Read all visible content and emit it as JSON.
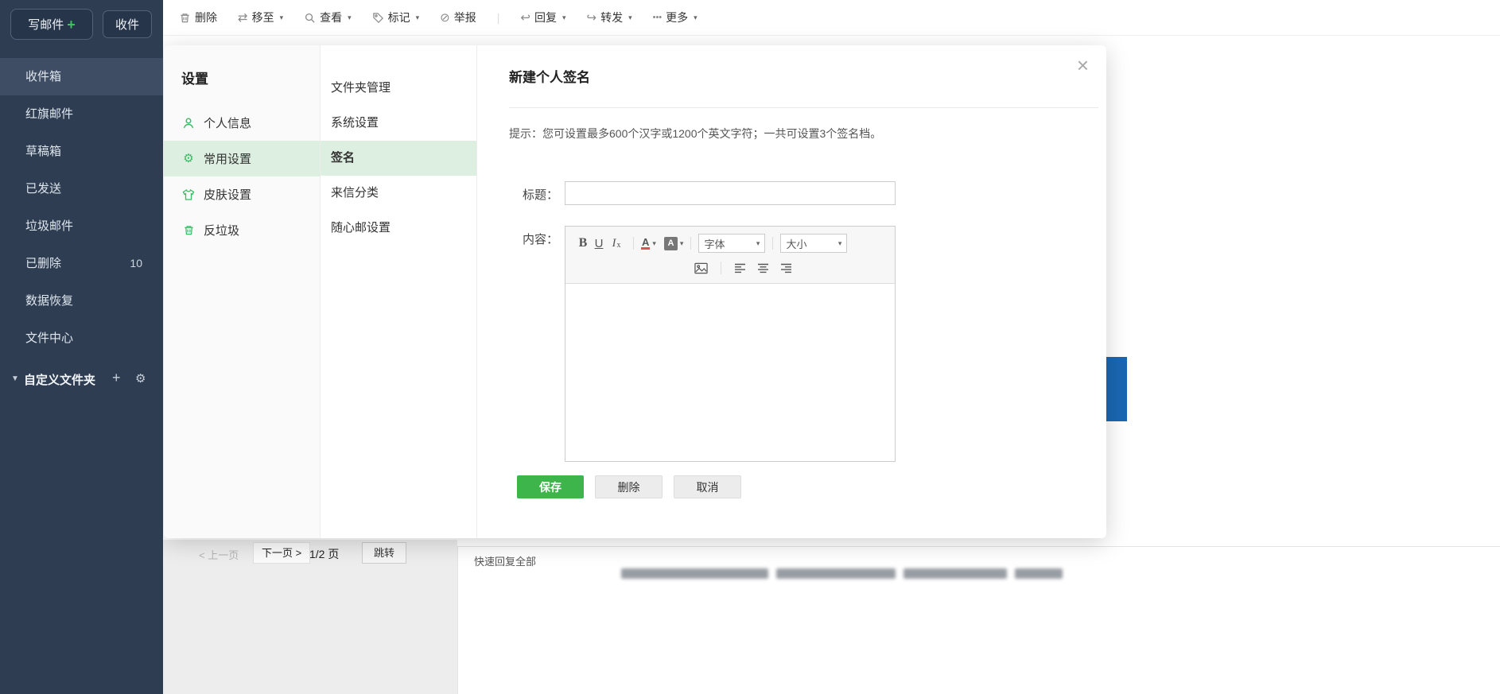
{
  "colors": {
    "accent_green": "#3db54a",
    "selection_green": "#dcefe0",
    "sidebar_bg": "#2e3d52",
    "sidebar_active_bg": "#3e4d63",
    "background_blue_fragment": "#1a67b2"
  },
  "icons": {
    "caret_down": "▾",
    "folder_caret": "▼",
    "plus": "+",
    "gear": "⚙",
    "close": "×",
    "more_dots": "•••",
    "pipe": "|",
    "prohibit": "⊘",
    "reply_arrow": "↩",
    "forward_arrow": "↪",
    "move_arrows": "⇄"
  },
  "sidebar": {
    "compose": "写邮件",
    "compose_plus": "+",
    "receive": "收件",
    "items": [
      {
        "label": "收件箱"
      },
      {
        "label": "红旗邮件"
      },
      {
        "label": "草稿箱"
      },
      {
        "label": "已发送"
      },
      {
        "label": "垃圾邮件"
      },
      {
        "label": "已删除",
        "badge": "10"
      },
      {
        "label": "数据恢复"
      },
      {
        "label": "文件中心"
      }
    ],
    "custom_folder": "自定义文件夹"
  },
  "toolbar": {
    "delete": "删除",
    "move_to": "移至",
    "view": "查看",
    "mark": "标记",
    "report": "举报",
    "reply": "回复",
    "forward": "转发",
    "more": "更多"
  },
  "modal": {
    "settings_title": "设置",
    "nav": [
      {
        "label": "个人信息"
      },
      {
        "label": "常用设置"
      },
      {
        "label": "皮肤设置"
      },
      {
        "label": "反垃圾"
      }
    ],
    "subnav": [
      {
        "label": "文件夹管理"
      },
      {
        "label": "系统设置"
      },
      {
        "label": "签名"
      },
      {
        "label": "来信分类"
      },
      {
        "label": "随心邮设置"
      }
    ],
    "signature": {
      "title": "新建个人签名",
      "tip": "提示：您可设置最多600个汉字或1200个英文字符；一共可设置3个签名档。",
      "title_label": "标题：",
      "content_label": "内容：",
      "toolbar": {
        "bold": "B",
        "underline": "U",
        "clear_i": "I",
        "clear_x": "x",
        "color_a": "A",
        "fill_a": "A",
        "font": "字体",
        "size": "大小"
      },
      "save": "保存",
      "delete": "删除",
      "cancel": "取消"
    }
  },
  "pagination": {
    "prev": "< 上一页",
    "next": "下一页 >",
    "page": "1/2 页",
    "jump": "跳转"
  },
  "reply_bar": {
    "quick_reply_all": "快速回复全部"
  }
}
